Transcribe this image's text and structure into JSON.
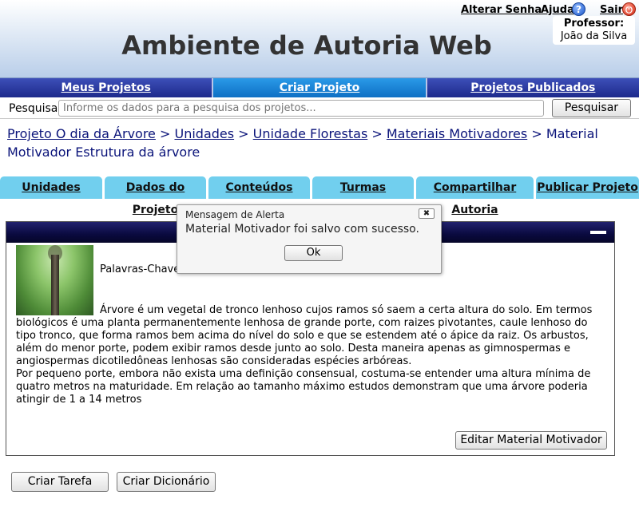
{
  "header": {
    "app_title": "Ambiente de Autoria Web",
    "change_password": "Alterar Senha",
    "help": "Ajuda",
    "help_icon": "question-circle-icon",
    "exit": "Sair",
    "exit_icon": "power-icon",
    "role": "Professor:",
    "user": "João da Silva"
  },
  "main_nav": {
    "items": [
      "Meus Projetos",
      "Criar Projeto",
      "Projetos Publicados"
    ],
    "active": "Criar Projeto"
  },
  "search": {
    "label": "Pesquisa",
    "placeholder": "Informe os dados para a pesquisa dos projetos...",
    "button": "Pesquisar"
  },
  "breadcrumb": {
    "links": [
      "Projeto O dia da Árvore",
      "Unidades",
      "Unidade Florestas",
      "Materiais Motivadores"
    ],
    "separator": ">",
    "current": "Material Motivador Estrutura da árvore"
  },
  "tabs": [
    "Unidades",
    "Dados do Projeto",
    "Conteúdos",
    "Turmas",
    "Compartilhar Autoria",
    "Publicar Projeto"
  ],
  "panel": {
    "keywords": "Palavras-Chave: Árvore, estrutura, folha, altura",
    "paragraphs": [
      "Árvore é um vegetal de tronco lenhoso cujos ramos só saem a certa altura do solo.   Em termos biológicos é uma planta permanentemente lenhosa de grande porte, com raizes pivotantes, caule lenhoso do tipo tronco, que forma ramos bem acima do nível do solo e que se estendem até o ápice da raiz. Os arbustos, além do menor porte, podem exibir ramos desde junto ao solo. Desta maneira apenas as gimnospermas e angiospermas dicotiledôneas lenhosas são consideradas espécies arbóreas.",
      "Por pequeno porte, embora não exista uma definição consensual, costuma-se entender uma altura mínima de quatro metros na maturidade. Em relação ao tamanho máximo estudos demonstram que uma árvore poderia atingir de 1 a 14 metros"
    ],
    "edit_button": "Editar Material Motivador"
  },
  "actions": {
    "create_task": "Criar Tarefa",
    "create_dictionary": "Criar Dicionário"
  },
  "alert": {
    "title": "Mensagem de Alerta",
    "close_icon": "close-icon",
    "message": "Material Motivador foi salvo com sucesso.",
    "ok": "Ok"
  },
  "colors": {
    "nav": "#1d2a8c",
    "nav_active": "#0e6fc4",
    "tab": "#71cfee",
    "breadcrumb": "#0b147a",
    "panel_header": "#0a0a3f"
  }
}
